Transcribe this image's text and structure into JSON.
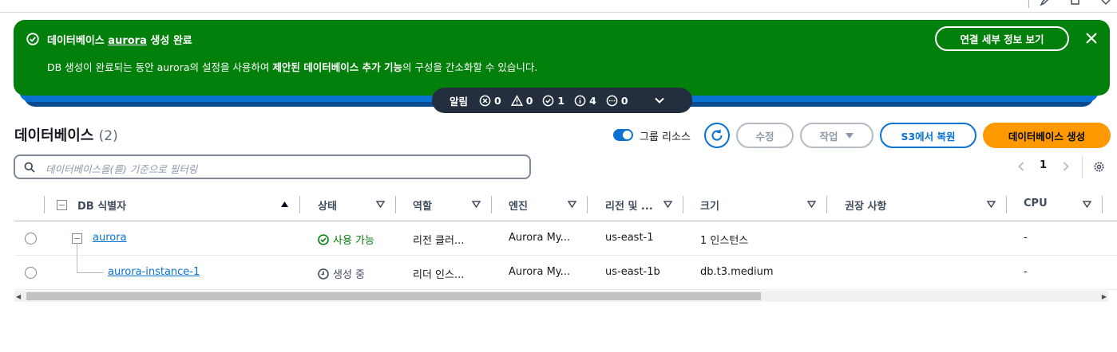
{
  "flash": {
    "title_prefix": "데이터베이스 ",
    "title_db": "aurora",
    "title_suffix": " 생성 완료",
    "body_part1": "DB 생성이 완료되는 동안 aurora의 설정을 사용하여 ",
    "body_bold": "제안된 데이터베이스 추가 기능",
    "body_part2": "의 구성을 간소화할 수 있습니다.",
    "detail_button": "연결 세부 정보 보기",
    "color": "#037f0c"
  },
  "notifications": {
    "label": "알림",
    "error": "0",
    "warning": "0",
    "success": "1",
    "info": "4",
    "in_progress": "0"
  },
  "header": {
    "title": "데이터베이스",
    "count": "(2)",
    "group_toggle_label": "그룹 리소스",
    "group_toggle_on": true
  },
  "buttons": {
    "edit": "수정",
    "actions": "작업",
    "restore_s3": "S3에서 복원",
    "create_db": "데이터베이스 생성"
  },
  "search": {
    "placeholder": "데이터베이스을(를) 기준으로 필터링"
  },
  "pagination": {
    "page": "1"
  },
  "table": {
    "columns": {
      "db_id": "DB 식별자",
      "status": "상태",
      "role": "역할",
      "engine": "엔진",
      "region": "리전 및 ...",
      "size": "크기",
      "recommendations": "권장 사항",
      "cpu": "CPU"
    },
    "rows": [
      {
        "db_id": "aurora",
        "status": "사용 가능",
        "role": "리전 클러...",
        "engine": "Aurora My...",
        "region": "us-east-1",
        "size": "1 인스턴스",
        "recommendations": "",
        "cpu": "-"
      },
      {
        "db_id": "aurora-instance-1",
        "status": "생성 중",
        "role": "리더 인스...",
        "engine": "Aurora My...",
        "region": "us-east-1b",
        "size": "db.t3.medium",
        "recommendations": "",
        "cpu": "-"
      }
    ]
  },
  "colors": {
    "primary": "#0972d3",
    "create_button": "#ff9900",
    "notification_bar": "#232f3e"
  }
}
